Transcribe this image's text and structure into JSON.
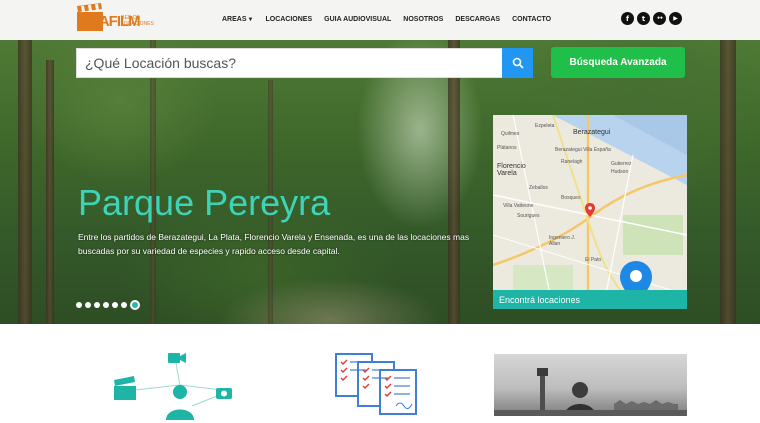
{
  "header": {
    "logo": {
      "text": "BAFILM",
      "tagline": "RED DE LOCACIONES"
    },
    "nav": [
      {
        "label": "AREAS",
        "has_caret": true
      },
      {
        "label": "LOCACIONES",
        "has_caret": false
      },
      {
        "label": "GUIA AUDIOVISUAL",
        "has_caret": false
      },
      {
        "label": "NOSOTROS",
        "has_caret": false
      },
      {
        "label": "DESCARGAS",
        "has_caret": false
      },
      {
        "label": "CONTACTO",
        "has_caret": false
      }
    ],
    "socials": [
      {
        "icon": "facebook-icon",
        "glyph": "f"
      },
      {
        "icon": "twitter-icon",
        "glyph": "t"
      },
      {
        "icon": "flickr-icon",
        "glyph": "••"
      },
      {
        "icon": "youtube-icon",
        "glyph": "▶"
      }
    ]
  },
  "search": {
    "placeholder": "¿Qué Locación buscas?",
    "advanced_label": "Búsqueda Avanzada"
  },
  "hero": {
    "title": "Parque Pereyra",
    "description": "Entre los partidos de Berazategui, La Plata, Florencio Varela y Ensenada, es una de las locaciones mas buscadas por su variedad de especies y rapido acceso desde capital.",
    "slides_total": 7,
    "slide_active_index": 6
  },
  "map": {
    "footer_label": "Encontrá locaciones",
    "places": [
      "Berazategui",
      "Florencio Varela",
      "Plátanos",
      "Ranelagh",
      "Zeballos",
      "Hudson",
      "Gutierrez",
      "Villa Vatteone",
      "Sourigues",
      "El Pato",
      "Ingeniero J. Allan",
      "Bosques",
      "Berazategui Villa España",
      "Ezpeleta",
      "Quilmes"
    ]
  },
  "colors": {
    "accent_teal": "#3ed3b7",
    "search_blue": "#2196f3",
    "advanced_green": "#1fbf4a",
    "map_footer": "#1fb5a6",
    "logo_orange": "#e07a1f"
  }
}
